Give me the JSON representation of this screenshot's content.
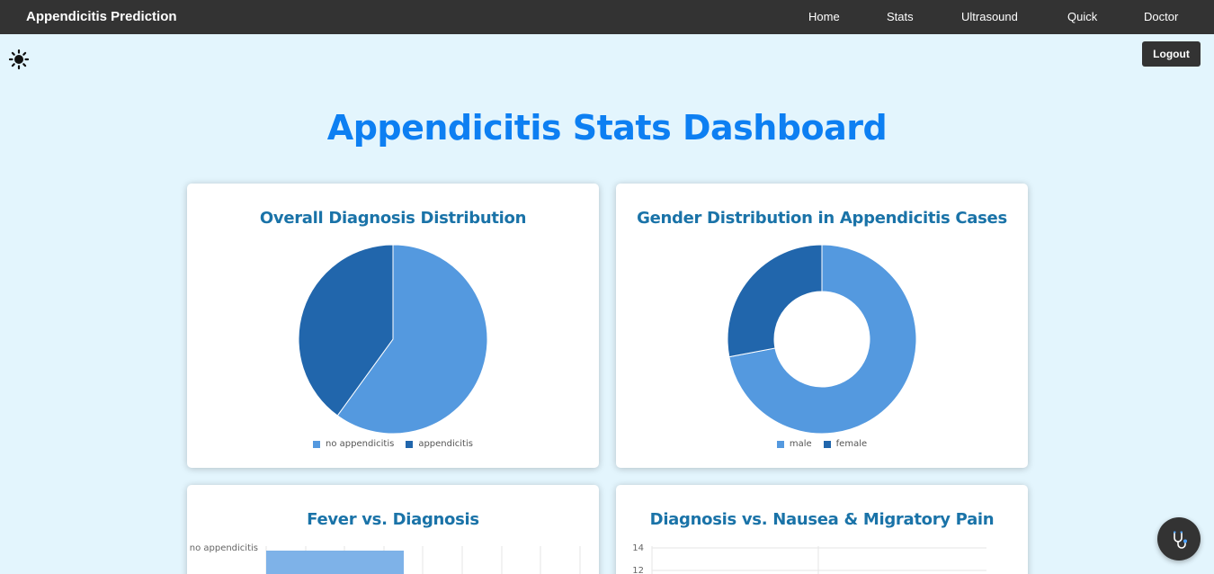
{
  "nav": {
    "brand": "Appendicitis Prediction",
    "links": [
      "Home",
      "Stats",
      "Ultrasound",
      "Quick",
      "Doctor"
    ]
  },
  "theme_toggle_icon": "sun-icon",
  "logout_label": "Logout",
  "page_title": "Appendicitis Stats Dashboard",
  "colors": {
    "light_blue": "#5499df",
    "dark_blue": "#2166ac",
    "bar_blue": "#7eb2e8",
    "title_blue": "#0d7ff2",
    "card_title_blue": "#1a73a8",
    "nav_bg": "#333333",
    "page_bg": "#e3f5fd"
  },
  "cards": {
    "diagnosis": {
      "title": "Overall Diagnosis Distribution"
    },
    "gender": {
      "title": "Gender Distribution in Appendicitis Cases"
    },
    "fever": {
      "title": "Fever vs. Diagnosis"
    },
    "nausea": {
      "title": "Diagnosis vs. Nausea & Migratory Pain"
    }
  },
  "chart_data": [
    {
      "type": "pie",
      "title": "Overall Diagnosis Distribution",
      "labels": [
        "no appendicitis",
        "appendicitis"
      ],
      "values": [
        60,
        40
      ],
      "colors": [
        "#5499df",
        "#2166ac"
      ],
      "legend": "bottom"
    },
    {
      "type": "pie",
      "subtype": "doughnut",
      "title": "Gender Distribution in Appendicitis Cases",
      "labels": [
        "male",
        "female"
      ],
      "values": [
        72,
        28
      ],
      "colors": [
        "#5499df",
        "#2166ac"
      ],
      "legend": "bottom"
    },
    {
      "type": "bar",
      "orientation": "horizontal",
      "title": "Fever vs. Diagnosis",
      "categories": [
        "no appendicitis"
      ],
      "values": [
        35
      ]
    },
    {
      "type": "bar",
      "title": "Diagnosis vs. Nausea & Migratory Pain",
      "y_ticks": [
        14,
        12
      ]
    }
  ],
  "fab_icon": "stethoscope-icon"
}
